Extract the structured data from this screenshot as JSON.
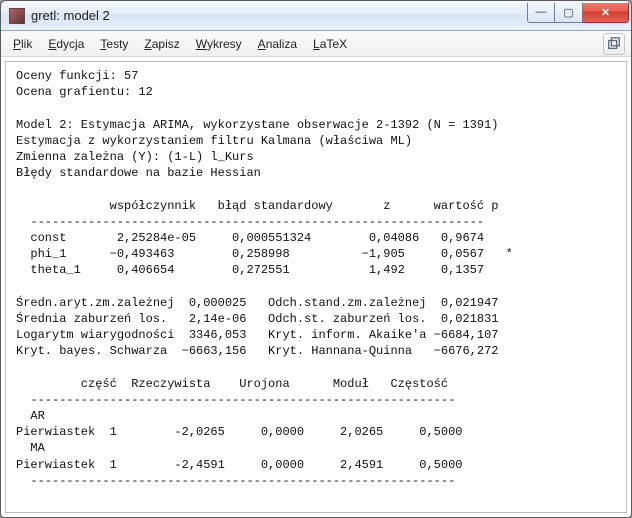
{
  "window": {
    "title": "gretl: model 2"
  },
  "menu": {
    "plik": "Plik",
    "edycja": "Edycja",
    "testy": "Testy",
    "zapisz": "Zapisz",
    "wykresy": "Wykresy",
    "analiza": "Analiza",
    "latex": "LaTeX"
  },
  "winbtn": {
    "min": "—",
    "max": "▢",
    "close": "✕"
  },
  "out": {
    "l01": "Oceny funkcji: 57",
    "l02": "Ocena grafientu: 12",
    "l03": "",
    "l04": "Model 2: Estymacja ARIMA, wykorzystane obserwacje 2-1392 (N = 1391)",
    "l05": "Estymacja z wykorzystaniem filtru Kalmana (właściwa ML)",
    "l06": "Zmienna zależna (Y): (1-L) l_Kurs",
    "l07": "Błędy standardowe na bazie Hessian",
    "l08": "",
    "l09": "             współczynnik   błąd standardowy       z      wartość p",
    "l10": "  ---------------------------------------------------------------",
    "l11": "  const       2,25284e-05     0,000551324        0,04086   0,9674 ",
    "l12": "  phi_1      −0,493463        0,258998          −1,905     0,0567   *",
    "l13": "  theta_1     0,406654        0,272551           1,492     0,1357 ",
    "l14": "",
    "l15": "Średn.aryt.zm.zależnej  0,000025   Odch.stand.zm.zależnej  0,021947",
    "l16": "Średnia zaburzeń los.   2,14e-06   Odch.st. zaburzeń los.  0,021831",
    "l17": "Logarytm wiarygodności  3346,053   Kryt. inform. Akaike'a −6684,107",
    "l18": "Kryt. bayes. Schwarza  −6663,156   Kryt. Hannana-Quinna   −6676,272",
    "l19": "",
    "l20": "         część  Rzeczywista    Urojona      Moduł   Częstość",
    "l21": "  -----------------------------------------------------------",
    "l22": "  AR",
    "l23": "Pierwiastek  1        -2,0265     0,0000     2,0265     0,5000",
    "l24": "  MA",
    "l25": "Pierwiastek  1        -2,4591     0,0000     2,4591     0,5000",
    "l26": "  -----------------------------------------------------------"
  }
}
